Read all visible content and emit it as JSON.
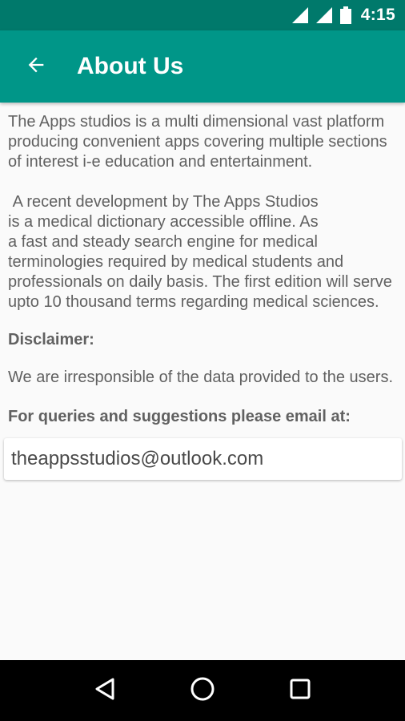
{
  "status_bar": {
    "time": "4:15",
    "icons": [
      "signal-icon",
      "signal-icon",
      "battery-icon"
    ]
  },
  "app_bar": {
    "title": "About Us",
    "back_icon": "arrow-back-icon"
  },
  "content": {
    "intro": "The Apps studios is a multi dimensional vast platform producing convenient apps covering multiple sections of interest i-e education and entertainment.",
    "development": " A recent development by The Apps Studios\nis a medical dictionary accessible offline. As\na fast and steady search engine for medical terminologies required by medical students and professionals on daily basis. The first edition will serve upto 10 thousand terms regarding medical sciences.",
    "disclaimer_heading": "Disclaimer:",
    "disclaimer_text": "We are irresponsible of the data provided to the users.",
    "queries_heading": "For queries and suggestions please email at:",
    "email": "theappsstudios@outlook.com"
  },
  "nav_bar": {
    "buttons": [
      "back-triangle-icon",
      "home-circle-icon",
      "recents-square-icon"
    ]
  },
  "colors": {
    "status_bar": "#00796b",
    "app_bar": "#009688",
    "background": "#fafafa",
    "text": "#616161"
  }
}
